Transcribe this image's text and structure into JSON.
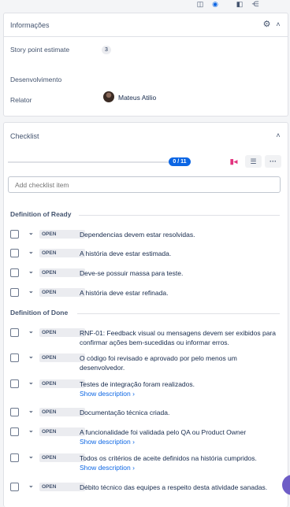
{
  "top_icons": [
    "info-icon",
    "user-icon",
    "copy-icon",
    "share-icon"
  ],
  "info_panel": {
    "title": "Informações",
    "fields": [
      {
        "label": "Story point estimate",
        "value": "3"
      },
      {
        "label": "Desenvolvimento",
        "value": ""
      },
      {
        "label": "Relator",
        "value": "Mateus Atilio"
      }
    ]
  },
  "checklist": {
    "title": "Checklist",
    "progress": {
      "done": 0,
      "total": 11,
      "label": "0 / 11",
      "fraction": 0.0
    },
    "add_placeholder": "Add checklist item",
    "sections": [
      {
        "title": "Definition of Ready",
        "items": [
          {
            "status": "OPEN",
            "text": "Dependencias devem estar resolvidas."
          },
          {
            "status": "OPEN",
            "text": "A história deve estar estimada."
          },
          {
            "status": "OPEN",
            "text": "Deve-se possuir massa para teste."
          },
          {
            "status": "OPEN",
            "text": "A história deve estar refinada."
          }
        ]
      },
      {
        "title": "Definition of Done",
        "items": [
          {
            "status": "OPEN",
            "text": "RNF-01: Feedback visual ou mensagens devem ser exibidos para confirmar ações bem-sucedidas ou informar erros."
          },
          {
            "status": "OPEN",
            "text": "O código foi revisado e aprovado por pelo menos um desenvolvedor."
          },
          {
            "status": "OPEN",
            "text": "Testes de integração foram realizados.",
            "show": "Show description  ›"
          },
          {
            "status": "OPEN",
            "text": "Documentação técnica criada."
          },
          {
            "status": "OPEN",
            "text": "A funcionalidade foi validada pelo QA ou Product Owner",
            "show": "Show description  ›"
          },
          {
            "status": "OPEN",
            "text": "Todos os critérios de aceite definidos na história cumpridos.",
            "show": "Show description  ›"
          },
          {
            "status": "OPEN",
            "text": "Débito técnico das equipes a respeito desta atividade sanadas."
          }
        ]
      }
    ]
  },
  "colors": {
    "accent": "#0c66e4",
    "fab": "#6e5dc6",
    "flag": "#e2347f"
  }
}
